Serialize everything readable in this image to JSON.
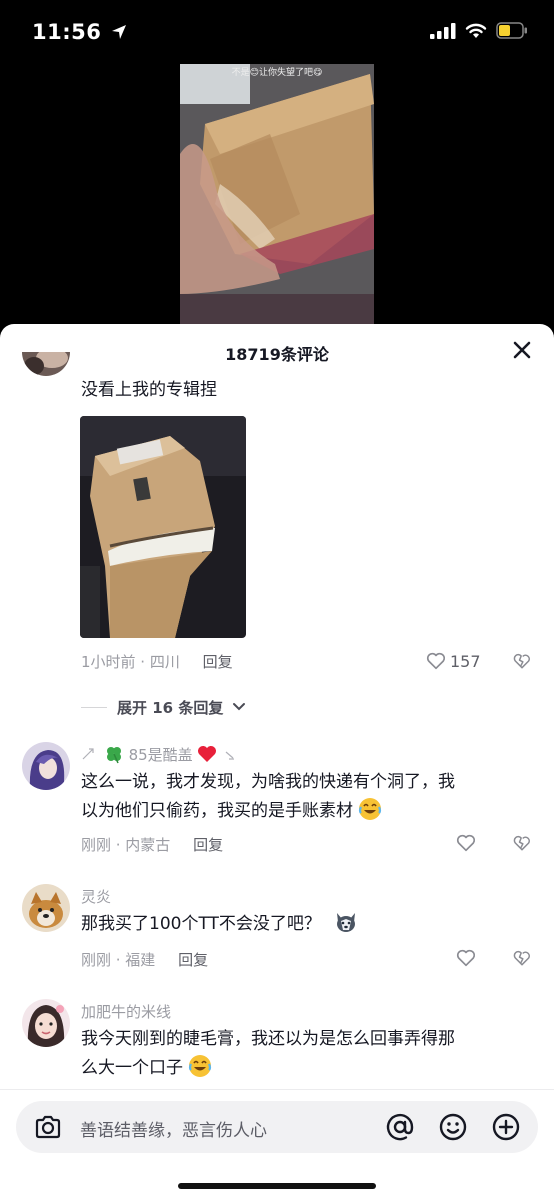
{
  "status_bar": {
    "time": "11:56"
  },
  "video": {
    "caption": "不是😊让你失望了吧😋"
  },
  "sheet": {
    "comment_count": "18719条评论"
  },
  "comments": [
    {
      "text": "没看上我的专辑捏",
      "meta": "1小时前 · 四川",
      "reply_label": "回复",
      "likes": "157",
      "expand_label": "展开 16 条回复"
    },
    {
      "username": "85是酷盖",
      "text_line1": "这么一说，我才发现，为啥我的快递有个洞了，我",
      "text_line2": "以为他们只偷药，我买的是手账素材",
      "meta": "刚刚 · 内蒙古",
      "reply_label": "回复"
    },
    {
      "username": "灵炎",
      "text": "那我买了100个TT不会没了吧？",
      "meta": "刚刚 · 福建",
      "reply_label": "回复"
    },
    {
      "username": "加肥牛的米线",
      "text_line1": "我今天刚到的睫毛膏，我还以为是怎么回事弄得那",
      "text_line2": "么大一个口子"
    }
  ],
  "input": {
    "placeholder": "善语结善缘，恶言伤人心"
  },
  "icons": {
    "close": "close-icon",
    "camera": "camera-icon",
    "at": "at-icon",
    "emoji": "emoji-icon",
    "plus": "plus-icon",
    "heart": "heart-icon",
    "dislike": "dislike-icon"
  },
  "colors": {
    "text": "#161823",
    "meta": "#9b9ca3",
    "heart_red": "#e8203a",
    "clover_green": "#3aa84a"
  }
}
